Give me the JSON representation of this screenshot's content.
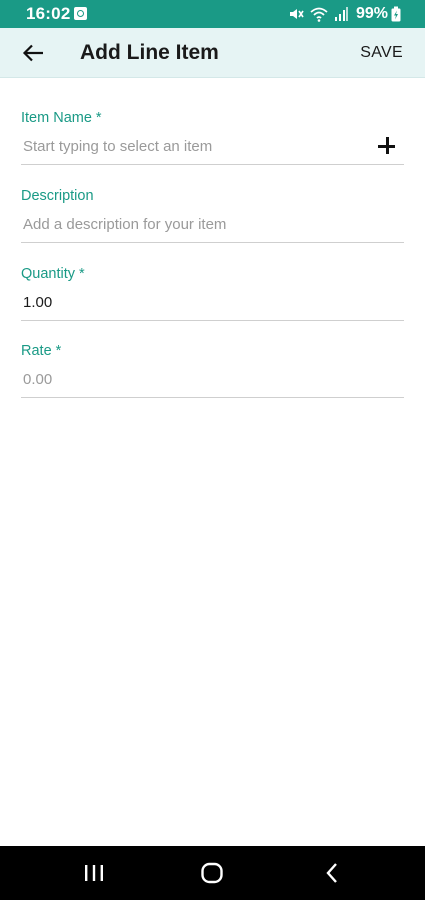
{
  "status_bar": {
    "time": "16:02",
    "battery": "99%",
    "icons": [
      "notification-icon",
      "mute-icon",
      "wifi-icon",
      "signal-icon",
      "battery-charging-icon"
    ]
  },
  "app_bar": {
    "title": "Add Line Item",
    "save_label": "SAVE",
    "back_icon": "arrow-left-icon"
  },
  "form": {
    "item_name": {
      "label": "Item Name *",
      "placeholder": "Start typing to select an item",
      "action_icon": "plus-icon"
    },
    "description": {
      "label": "Description",
      "placeholder": "Add a description for your item"
    },
    "quantity": {
      "label": "Quantity *",
      "value": "1.00"
    },
    "rate": {
      "label": "Rate *",
      "placeholder": "0.00"
    }
  },
  "nav_bar": {
    "icons": [
      "recent-apps-icon",
      "home-icon",
      "back-icon"
    ]
  },
  "colors": {
    "primary": "#1a9a86",
    "app_bar_bg": "#e6f4f4",
    "placeholder": "#9a9a9a",
    "divider": "#cfcfcf"
  }
}
